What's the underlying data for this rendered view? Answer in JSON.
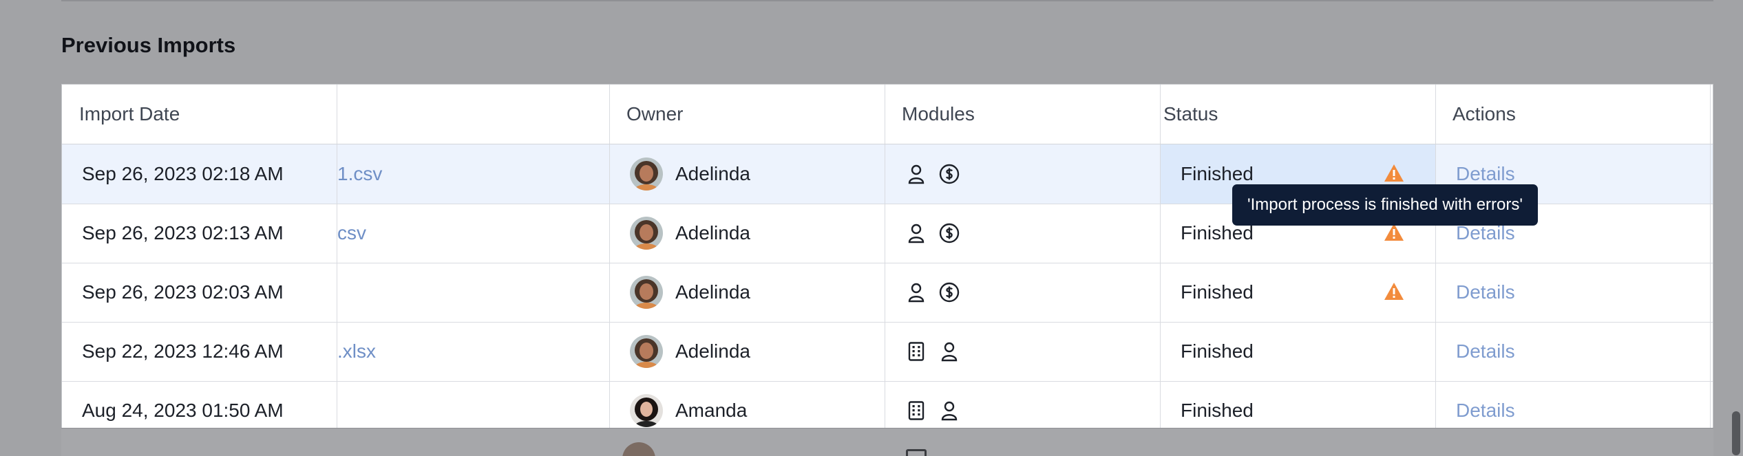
{
  "section": {
    "title": "Previous Imports"
  },
  "table": {
    "headers": [
      "Import Date",
      "",
      "Owner",
      "Modules",
      "Status",
      "Actions"
    ],
    "rows": [
      {
        "date": "Sep 26, 2023 02:18 AM",
        "file": "1.csv",
        "owner": "Adelinda",
        "modules": [
          "person-icon",
          "dollar-circle-icon"
        ],
        "status": "Finished",
        "warning": true,
        "action": "Details"
      },
      {
        "date": "Sep 26, 2023 02:13 AM",
        "file": "csv",
        "owner": "Adelinda",
        "modules": [
          "person-icon",
          "dollar-circle-icon"
        ],
        "status": "Finished",
        "warning": true,
        "action": "Details"
      },
      {
        "date": "Sep 26, 2023 02:03 AM",
        "file": "",
        "owner": "Adelinda",
        "modules": [
          "person-icon",
          "dollar-circle-icon"
        ],
        "status": "Finished",
        "warning": true,
        "action": "Details"
      },
      {
        "date": "Sep 22, 2023 12:46 AM",
        "file": ".xlsx",
        "owner": "Adelinda",
        "modules": [
          "building-icon",
          "person-icon"
        ],
        "status": "Finished",
        "warning": false,
        "action": "Details"
      },
      {
        "date": "Aug 24, 2023 01:50 AM",
        "file": "",
        "owner": "Amanda",
        "modules": [
          "building-icon",
          "person-icon"
        ],
        "status": "Finished",
        "warning": false,
        "action": "Details"
      }
    ]
  },
  "tooltip": {
    "text": "'Import process is finished with errors'"
  },
  "colors": {
    "link": "#6f8fc6",
    "warning": "#f28b3c",
    "tooltip_bg": "#0f1d36",
    "row_highlight": "#edf3fd"
  }
}
